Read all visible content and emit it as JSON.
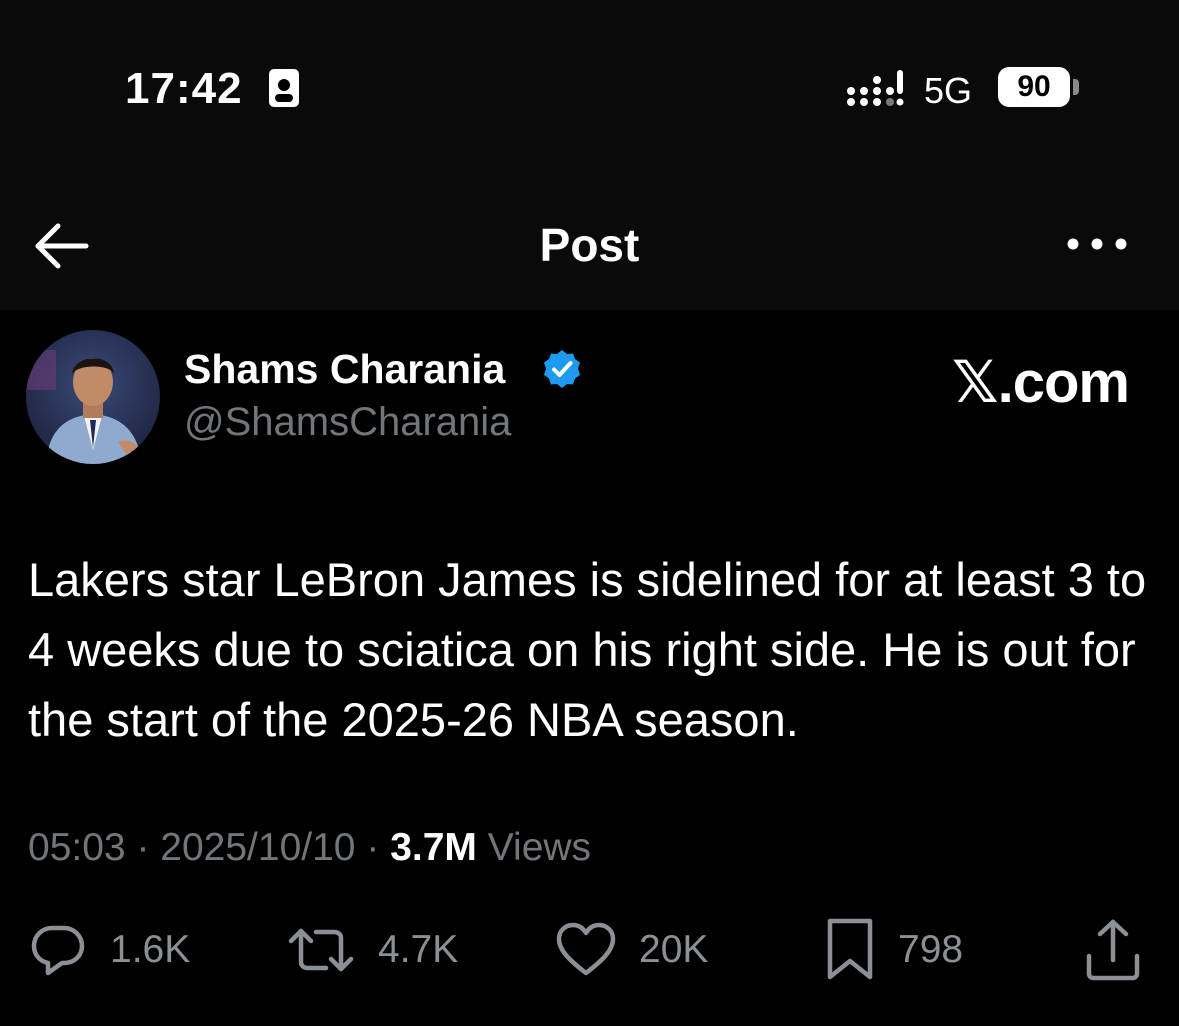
{
  "status_bar": {
    "time": "17:42",
    "network": "5G",
    "battery_level": "90",
    "focus_icon": "person-card-icon",
    "signal_icon": "signal-bars-icon"
  },
  "header": {
    "title": "Post",
    "back_icon": "arrow-left-icon",
    "more_icon": "more-dots-icon"
  },
  "post": {
    "author": {
      "name": "Shams Charania",
      "handle": "@ShamsCharania",
      "verified": true,
      "verified_color": "#1d9bf0"
    },
    "site_label": "𝕏.com",
    "text": "Lakers star LeBron James is sidelined for at least 3 to 4 weeks due to sciatica on his right side. He is out for the start of the 2025-26 NBA season.",
    "time": "05:03",
    "separator": "·",
    "date": "2025/10/10",
    "views_count": "3.7M",
    "views_label": "Views"
  },
  "actions": [
    {
      "name": "reply",
      "icon": "reply-bubble-icon",
      "count": "1.6K"
    },
    {
      "name": "repost",
      "icon": "repost-arrows-icon",
      "count": "4.7K"
    },
    {
      "name": "like",
      "icon": "heart-icon",
      "count": "20K"
    },
    {
      "name": "bookmark",
      "icon": "bookmark-icon",
      "count": "798"
    },
    {
      "name": "share",
      "icon": "share-upload-icon"
    }
  ],
  "colors": {
    "background": "#000000",
    "text_primary": "#ffffff",
    "text_secondary": "#71767b",
    "verified": "#1d9bf0"
  }
}
